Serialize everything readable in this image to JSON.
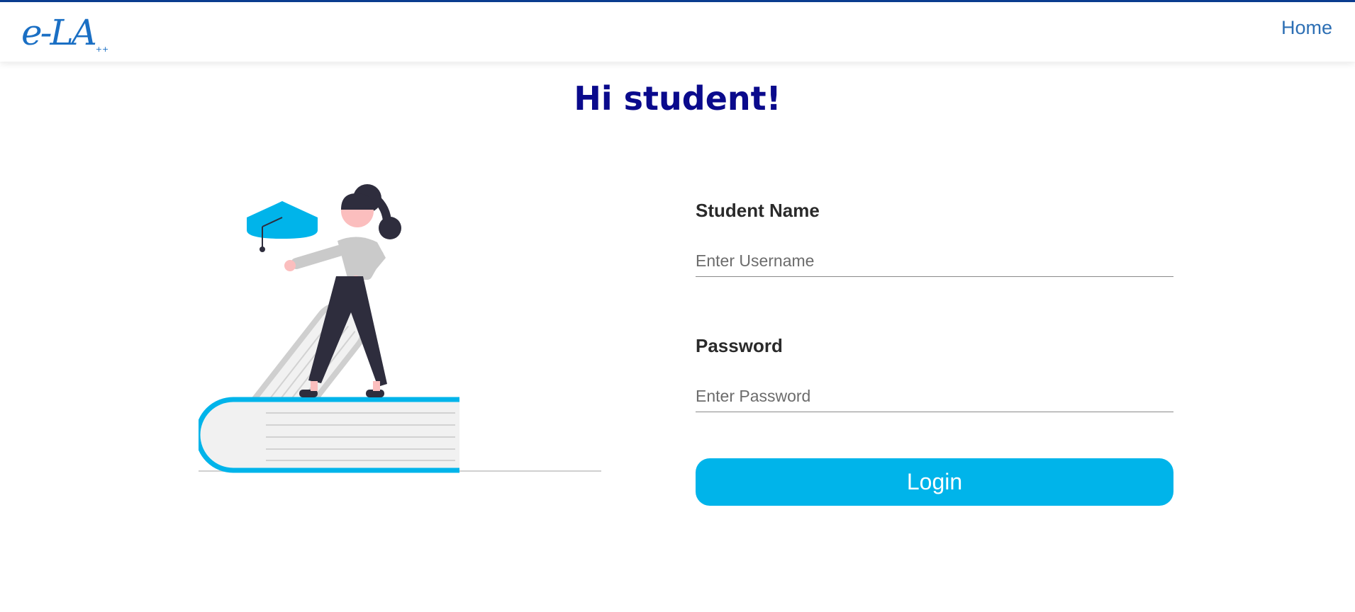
{
  "navbar": {
    "logo_text": "e-LA",
    "logo_superscript": "++",
    "home_link": "Home"
  },
  "page": {
    "title": "Hi student!"
  },
  "form": {
    "username_label": "Student Name",
    "username_placeholder": "Enter Username",
    "password_label": "Password",
    "password_placeholder": "Enter Password",
    "login_button": "Login"
  },
  "colors": {
    "accent": "#00b4ea",
    "title": "#0a0a8c",
    "link": "#2d6fb4",
    "topline": "#0b3d91"
  },
  "icons": {
    "illustration": "student-on-books-illustration"
  }
}
